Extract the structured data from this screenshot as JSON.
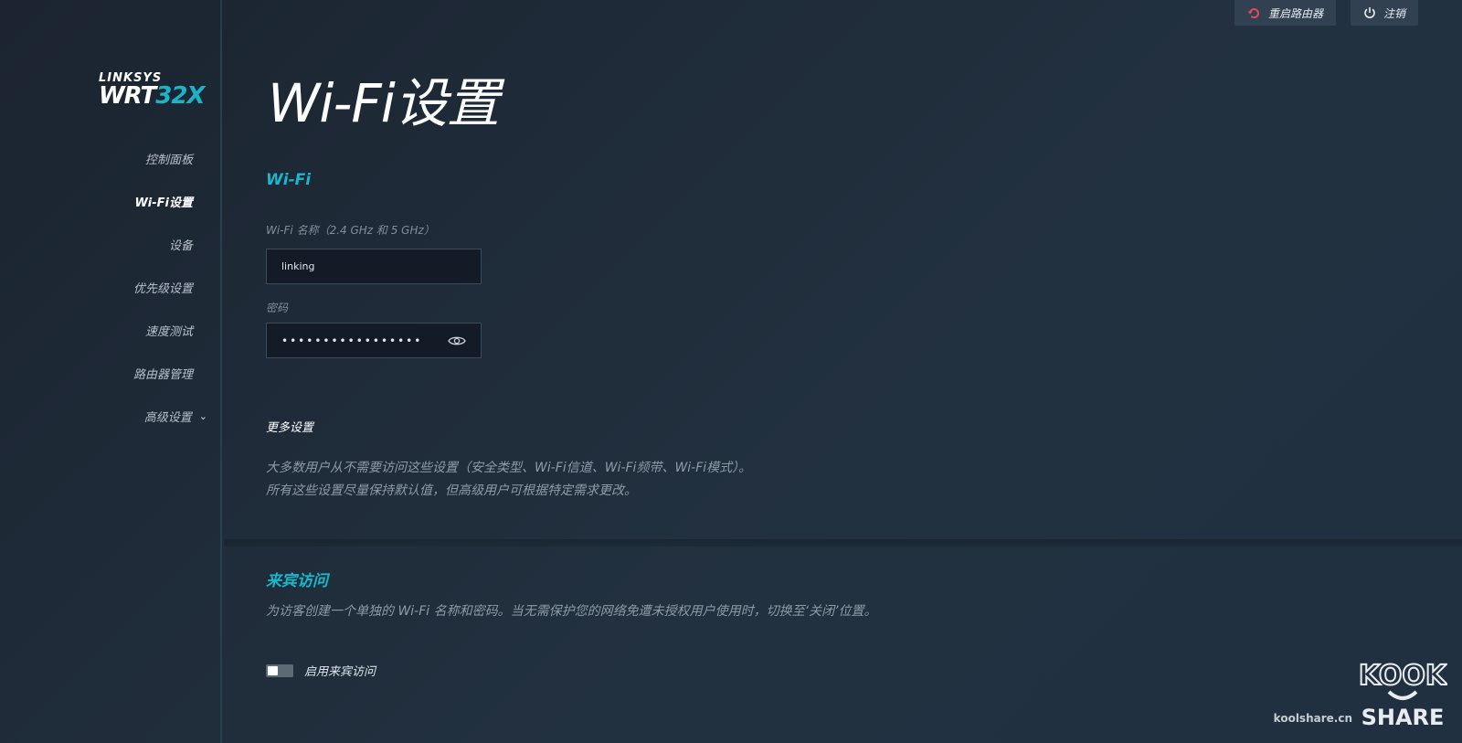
{
  "top_actions": {
    "restart_label": "重启路由器",
    "logout_label": "注销"
  },
  "logo": {
    "brand": "LINKSYS",
    "model_prefix": "WRT",
    "model_suffix": "32X"
  },
  "sidebar": {
    "items": [
      {
        "label": "控制面板"
      },
      {
        "label": "Wi-Fi设置"
      },
      {
        "label": "设备"
      },
      {
        "label": "优先级设置"
      },
      {
        "label": "速度测试"
      },
      {
        "label": "路由器管理"
      },
      {
        "label": "高级设置"
      }
    ]
  },
  "main": {
    "title": "Wi-Fi设置",
    "wifi_section": {
      "title": "Wi-Fi",
      "name_label": "Wi-Fi 名称（2.4 GHz 和 5 GHz）",
      "name_value": "linking",
      "password_label": "密码",
      "password_value": "•••••••••••••••••"
    },
    "more": {
      "title": "更多设置",
      "desc_line1": "大多数用户从不需要访问这些设置（安全类型、Wi-Fi信道、Wi-Fi频带、Wi-Fi模式）。",
      "desc_line2": "所有这些设置尽量保持默认值，但高级用户可根据特定需求更改。"
    },
    "guest": {
      "title": "来宾访问",
      "desc": "为访客创建一个单独的 Wi-Fi 名称和密码。当无需保护您的网络免遭未授权用户使用时，切换至‘关闭’位置。",
      "toggle_label": "启用来宾访问",
      "enabled": false
    }
  },
  "watermark": {
    "site": "koolshare.cn",
    "logo_top": "KOOK",
    "logo_bottom": "SHARE"
  },
  "colors": {
    "accent": "#17b7cc",
    "background": "#1e2a36",
    "restart_icon": "#e24b5b"
  }
}
